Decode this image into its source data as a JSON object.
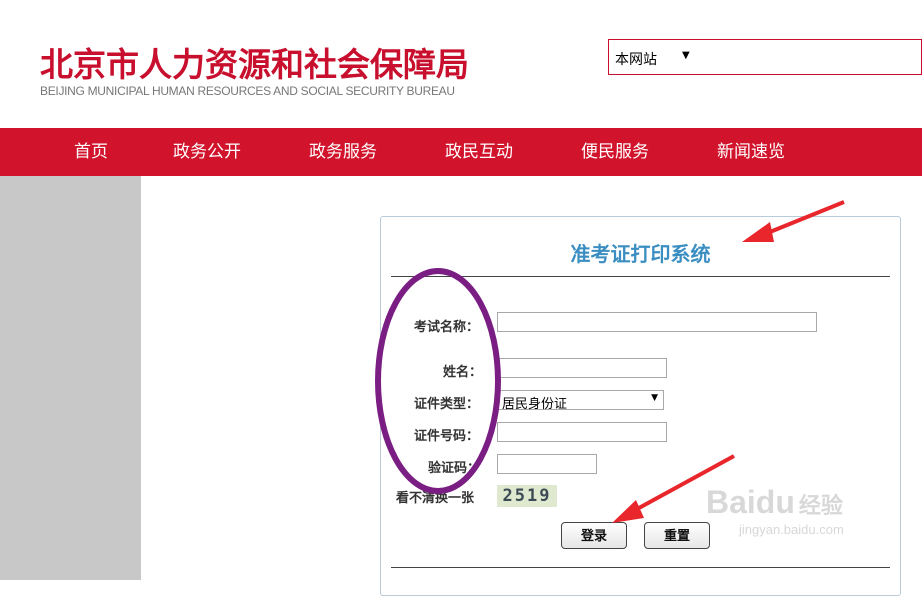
{
  "header": {
    "title_cn": "北京市人力资源和社会保障局",
    "title_en": "BEIJING MUNICIPAL HUMAN RESOURCES AND SOCIAL SECURITY BUREAU",
    "site_select": "本网站"
  },
  "nav": {
    "items": [
      {
        "label": "首页"
      },
      {
        "label": "政务公开"
      },
      {
        "label": "政务服务"
      },
      {
        "label": "政民互动"
      },
      {
        "label": "便民服务"
      },
      {
        "label": "新闻速览"
      }
    ]
  },
  "form": {
    "title": "准考证打印系统",
    "exam_name_label": "考试名称：",
    "exam_name_value": "",
    "name_label": "姓名：",
    "name_value": "",
    "id_type_label": "证件类型：",
    "id_type_value": "居民身份证",
    "id_number_label": "证件号码：",
    "id_number_value": "",
    "captcha_label": "验证码：",
    "captcha_value": "",
    "refresh_label": "看不清换一张",
    "captcha_text": "2519",
    "login_button": "登录",
    "reset_button": "重置"
  },
  "watermark": {
    "logo": "Baidu",
    "cn": "经验",
    "url": "jingyan.baidu.com"
  },
  "colors": {
    "brand_red": "#d2132c",
    "title_blue": "#3b8ec2",
    "annotation_purple": "#7a1e83",
    "annotation_arrow": "#e8262b"
  },
  "icons": {
    "dropdown": "triangle-down"
  }
}
